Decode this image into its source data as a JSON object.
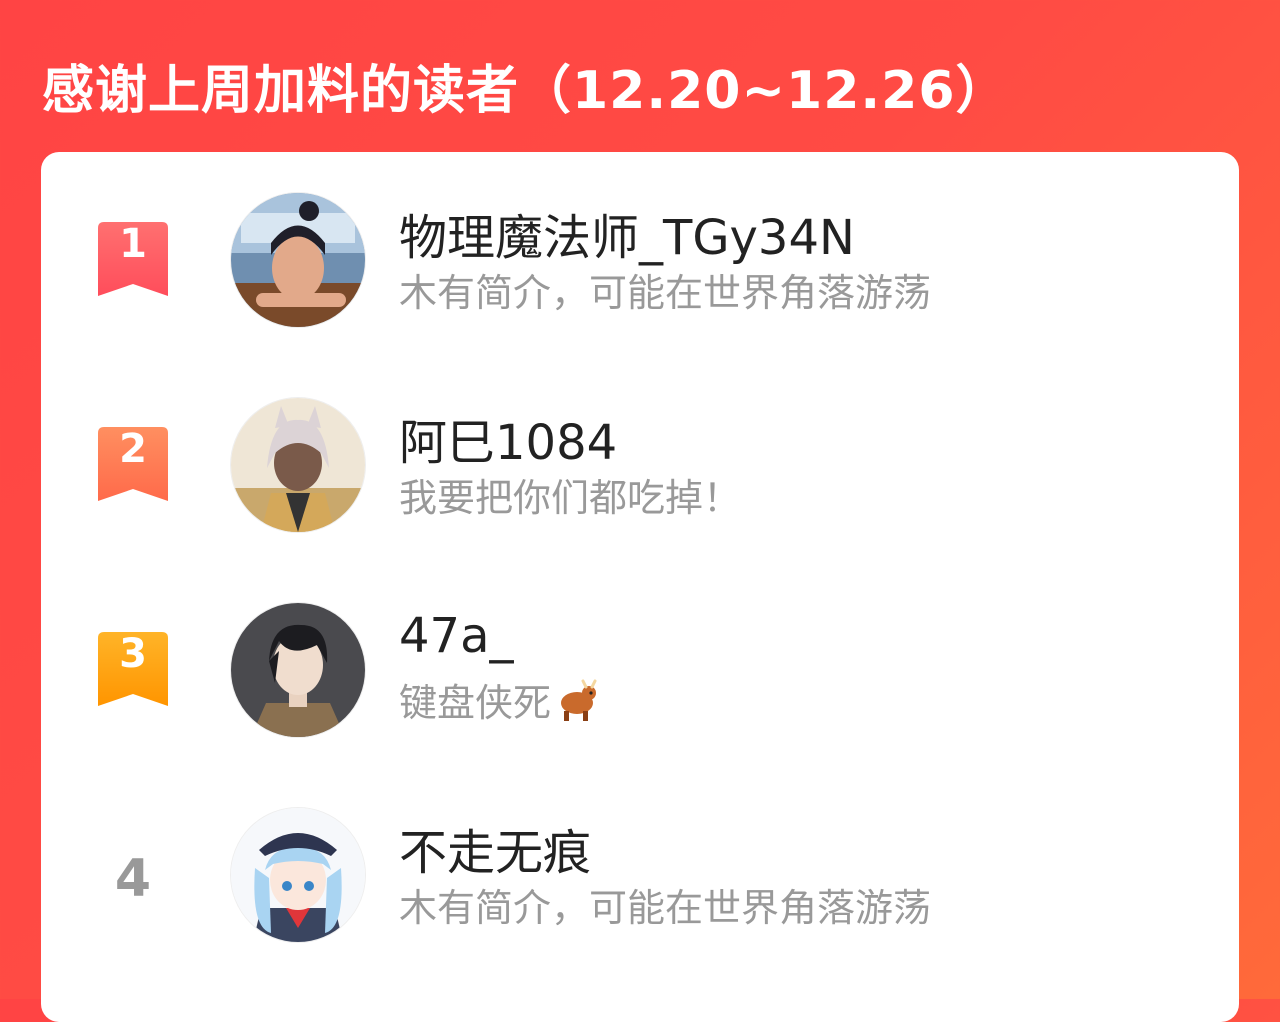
{
  "title": "感谢上周加料的读者（12.20~12.26）",
  "readers": [
    {
      "rank": "1",
      "name": "物理魔法师_TGy34N",
      "bio": "木有简介，可能在世界角落游荡",
      "badge_color_top": "#ff6b6b",
      "badge_color_bottom": "#ff4d5b"
    },
    {
      "rank": "2",
      "name": "阿巳1084",
      "bio": "我要把你们都吃掉！",
      "badge_color_top": "#ff8a5c",
      "badge_color_bottom": "#ff6a4a"
    },
    {
      "rank": "3",
      "name": "47a_",
      "bio": "键盘侠死",
      "bio_emoji": "ox-icon",
      "badge_color_top": "#ffb020",
      "badge_color_bottom": "#ff9500"
    },
    {
      "rank": "4",
      "name": "不走无痕",
      "bio": "木有简介，可能在世界角落游荡"
    }
  ]
}
